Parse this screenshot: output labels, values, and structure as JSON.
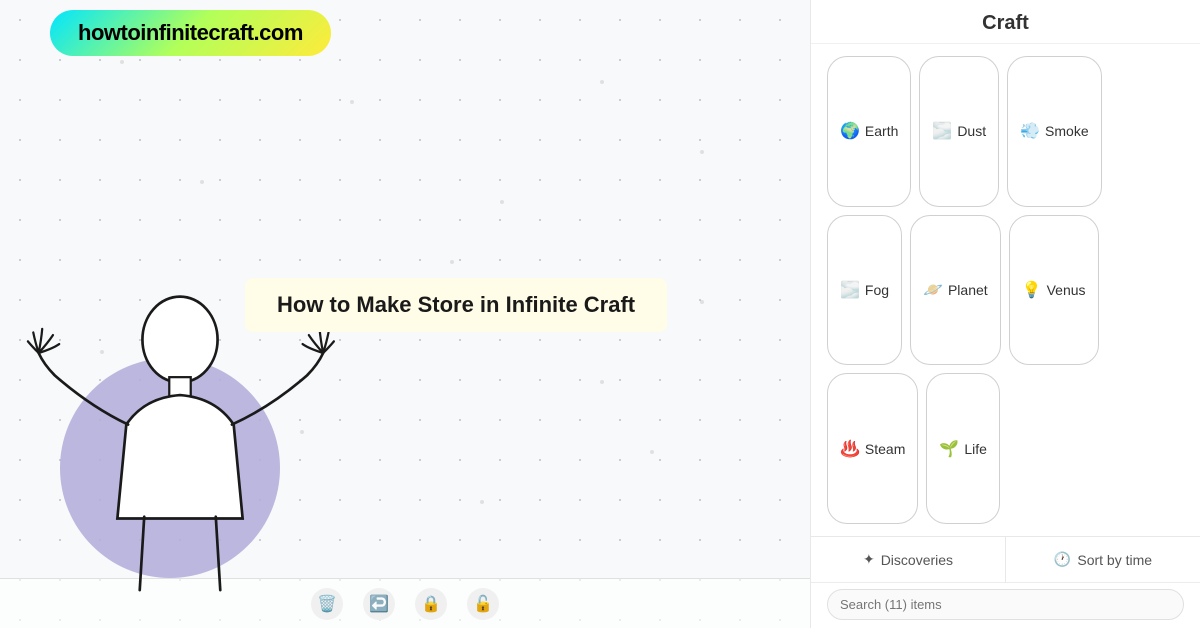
{
  "site": {
    "banner_text": "howtoinfinitecraft.com"
  },
  "header": {
    "craft_title": "Craft"
  },
  "page_title": "How to Make Store in Infinite Craft",
  "elements": [
    {
      "id": "earth",
      "emoji": "🌍",
      "label": "Earth"
    },
    {
      "id": "dust",
      "emoji": "🌫️",
      "label": "Dust"
    },
    {
      "id": "smoke",
      "emoji": "💨",
      "label": "Smoke"
    },
    {
      "id": "fog",
      "emoji": "🌫️",
      "label": "Fog"
    },
    {
      "id": "planet",
      "emoji": "🪐",
      "label": "Planet"
    },
    {
      "id": "venus",
      "emoji": "💡",
      "label": "Venus"
    },
    {
      "id": "steam",
      "emoji": "♨️",
      "label": "Steam"
    },
    {
      "id": "life",
      "emoji": "🌱",
      "label": "Life"
    }
  ],
  "bottom_bar": {
    "discoveries_label": "✦ Discoveries",
    "sort_by_time_label": "🕐 Sort by time"
  },
  "search": {
    "placeholder": "Search (11) items"
  },
  "toolbar_icons": [
    "🗑️",
    "↩️",
    "🔒",
    "🔓"
  ]
}
